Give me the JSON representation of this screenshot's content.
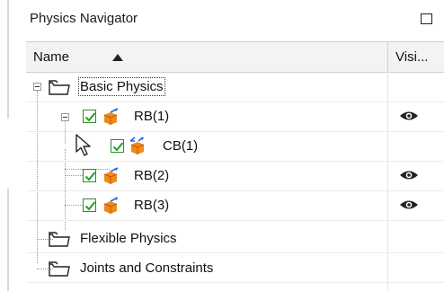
{
  "panel": {
    "title": "Physics Navigator"
  },
  "columns": {
    "name": "Name",
    "visibility": "Visi..."
  },
  "tree": [
    {
      "label": "Basic Physics",
      "type": "folder",
      "expanded": true,
      "visible": false
    },
    {
      "label": "RB(1)",
      "type": "rigid-body",
      "checked": true,
      "expanded": true,
      "visible": true
    },
    {
      "label": "CB(1)",
      "type": "constraint-body",
      "checked": true,
      "visible": false
    },
    {
      "label": "RB(2)",
      "type": "rigid-body",
      "checked": true,
      "visible": true
    },
    {
      "label": "RB(3)",
      "type": "rigid-body",
      "checked": true,
      "visible": true
    },
    {
      "label": "Flexible Physics",
      "type": "folder",
      "visible": false
    },
    {
      "label": "Joints and Constraints",
      "type": "folder",
      "visible": false
    }
  ],
  "colors": {
    "check": "#22a022",
    "cube": "#f08a1c",
    "arrow": "#2c5fd6",
    "header_bg": "#f3f3f3"
  }
}
